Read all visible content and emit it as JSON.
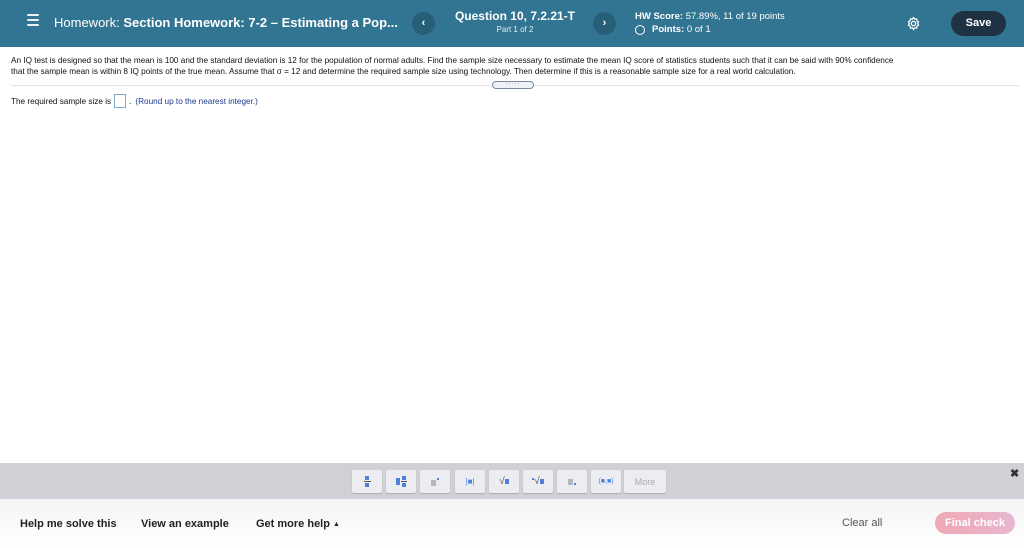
{
  "header": {
    "menu_icon": "hamburger-menu-icon",
    "homework_label": "Homework:",
    "homework_name": "Section Homework: 7-2 – Estimating a Pop...",
    "prev_glyph": "‹",
    "next_glyph": "›",
    "question_title": "Question 10, 7.2.21-T",
    "question_part": "Part 1 of 2",
    "hw_score_label": "HW Score:",
    "hw_score_value": "57.89%, 11 of 19 points",
    "points_label": "Points:",
    "points_value": "0 of 1",
    "settings_icon": "gear-icon",
    "save_label": "Save"
  },
  "question": {
    "prompt_line1": "An IQ test is designed so that the mean is 100 and the standard deviation is 12 for the population of normal adults. Find the sample size necessary to estimate the mean IQ score of statistics students such that it can be said with 90% confidence",
    "prompt_line2": "that the sample mean is within 8 IQ points of the true mean. Assume that σ = 12 and determine the required sample size using technology. Then determine if this is a reasonable sample size for a real world calculation.",
    "expand_glyph": "·····",
    "answer_prefix": "The required sample size is",
    "answer_value": "",
    "answer_suffix": ".",
    "answer_hint": "(Round up to the nearest integer.)"
  },
  "palette": {
    "buttons": [
      {
        "name": "fraction",
        "icon": "fraction-icon"
      },
      {
        "name": "mixed-number",
        "icon": "mixed-number-icon"
      },
      {
        "name": "exponent",
        "icon": "exponent-icon"
      },
      {
        "name": "absolute-value",
        "icon": "absolute-value-icon"
      },
      {
        "name": "square-root",
        "icon": "square-root-icon"
      },
      {
        "name": "nth-root",
        "icon": "nth-root-icon"
      },
      {
        "name": "decimal",
        "icon": "decimal-icon"
      },
      {
        "name": "ordered-pair",
        "icon": "ordered-pair-icon"
      }
    ],
    "abs_text": "|■|",
    "pair_text": "(■,■)",
    "more_label": "More",
    "close_glyph": "✖"
  },
  "footer": {
    "help_solve": "Help me solve this",
    "view_example": "View an example",
    "get_more_help": "Get more help",
    "help_caret": "▲",
    "clear_all": "Clear all",
    "final_check": "Final check"
  },
  "colors": {
    "header_bg": "#327592",
    "save_bg": "#1f3244",
    "palette_bg": "#cfd1d7",
    "final_check_bg": "#f0a8b3",
    "hint_color": "#1a3a8c"
  }
}
